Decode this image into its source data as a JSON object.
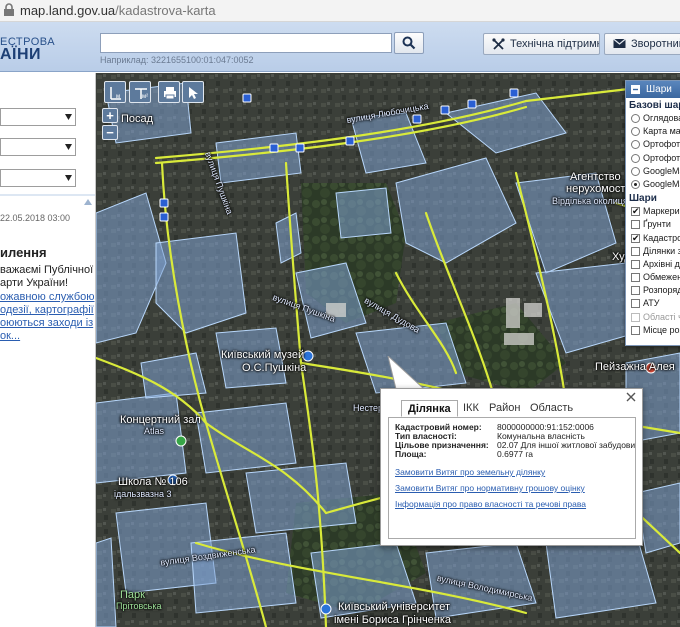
{
  "address_bar": {
    "domain": "map.land.gov.ua",
    "path": "/kadastrova-karta"
  },
  "header": {
    "logo_line1": "ЕСТРОВА",
    "logo_line2": "АЇНИ",
    "search_value": "",
    "search_example": "Наприклад: 3221655100:01:047:0052",
    "support_label": "Технічна підтримка",
    "feedback_label": "Зворотний зв"
  },
  "left_panel": {
    "date": "22.05.2018 03:00",
    "notice_title": "илення",
    "notice_lines": [
      "важаємі Публічної",
      "арти України!"
    ],
    "notice_links": [
      "ожавною службою",
      "одезії, картографії",
      "оюються заходи із",
      "ок..."
    ]
  },
  "map": {
    "toolbar": {
      "measure1": "м",
      "measure2": "м²"
    },
    "zoom_in": "+",
    "zoom_out": "−",
    "labels": {
      "posad": "Посад",
      "street_liubochytska": "вулиця Любочицька",
      "street_pushkina_left": "вулиця Пушкіна",
      "street_dudova": "вулиця Дудова",
      "street_pushkina_mid": "вулиця Пушкіна",
      "museum1": "Київський музей",
      "museum2": "О.С.Пушкіна",
      "hall1": "Концертний зал",
      "hall2": "Atlas",
      "school1": "Школа № 106",
      "school2": "ідальзвазна 3",
      "stanley1": "Агентство",
      "stanley2": "нерухомості",
      "stanley3": "Вірділька околиця",
      "khudozh": "Художн",
      "peizazhna": "Пейзажна Алея",
      "park1": "Парк",
      "park2": "Прітовська",
      "univ1": "Київський університет",
      "univ2": "імені Бориса Грінченка",
      "street_ivaschenka": "вулиця Воздвиженська",
      "street_nesterivsky": "Нестерівськ",
      "street_vladimirska": "вулиця Володимирська"
    },
    "layers_panel": {
      "title": "Шари",
      "base_heading": "Базові шари",
      "base_layers": [
        {
          "label": "Оглядова",
          "checked": false
        },
        {
          "label": "Карта ма",
          "checked": false
        },
        {
          "label": "Ортофото",
          "checked": false
        },
        {
          "label": "Ортофото",
          "checked": false
        },
        {
          "label": "GoogleMa",
          "checked": false
        },
        {
          "label": "GoogleMa",
          "checked": true
        }
      ],
      "layers_heading": "Шари",
      "layers": [
        {
          "label": "Маркери",
          "checked": true,
          "disabled": false
        },
        {
          "label": "Ґрунти",
          "checked": false,
          "disabled": false
        },
        {
          "label": "Кадастро",
          "checked": true,
          "disabled": false
        },
        {
          "label": "Ділянки з",
          "checked": false,
          "disabled": false
        },
        {
          "label": "Архівні ді",
          "checked": false,
          "disabled": false
        },
        {
          "label": "Обмежен",
          "checked": false,
          "disabled": false
        },
        {
          "label": "Розпоряд",
          "checked": false,
          "disabled": false
        },
        {
          "label": "АТУ",
          "checked": false,
          "disabled": false
        },
        {
          "label": "Області ч",
          "checked": false,
          "disabled": true
        },
        {
          "label": "Місце роз",
          "checked": false,
          "disabled": false
        }
      ]
    },
    "popup": {
      "tabs": [
        "Ділянка",
        "ІКК",
        "Район",
        "Область"
      ],
      "active_tab": "Ділянка",
      "info": [
        {
          "key": "Кадастровий номер:",
          "value": "8000000000:91:152:0006"
        },
        {
          "key": "Тип власності:",
          "value": "Комунальна власність"
        },
        {
          "key": "Цільове призначення:",
          "value": "02.07 Для іншої житлової забудови"
        },
        {
          "key": "Площа:",
          "value": "0.6977 га"
        }
      ],
      "links": [
        "Замовити Витяг про земельну ділянку",
        "Замовити Витяг про нормативну грошову оцінку",
        "Інформація про право власності та речові права"
      ]
    }
  },
  "colors": {
    "parcel_fill": "#7fa3d1",
    "parcel_stroke": "#a9cdf5",
    "road": "#d9ea3a",
    "header_bg": "#c4d5ec"
  }
}
